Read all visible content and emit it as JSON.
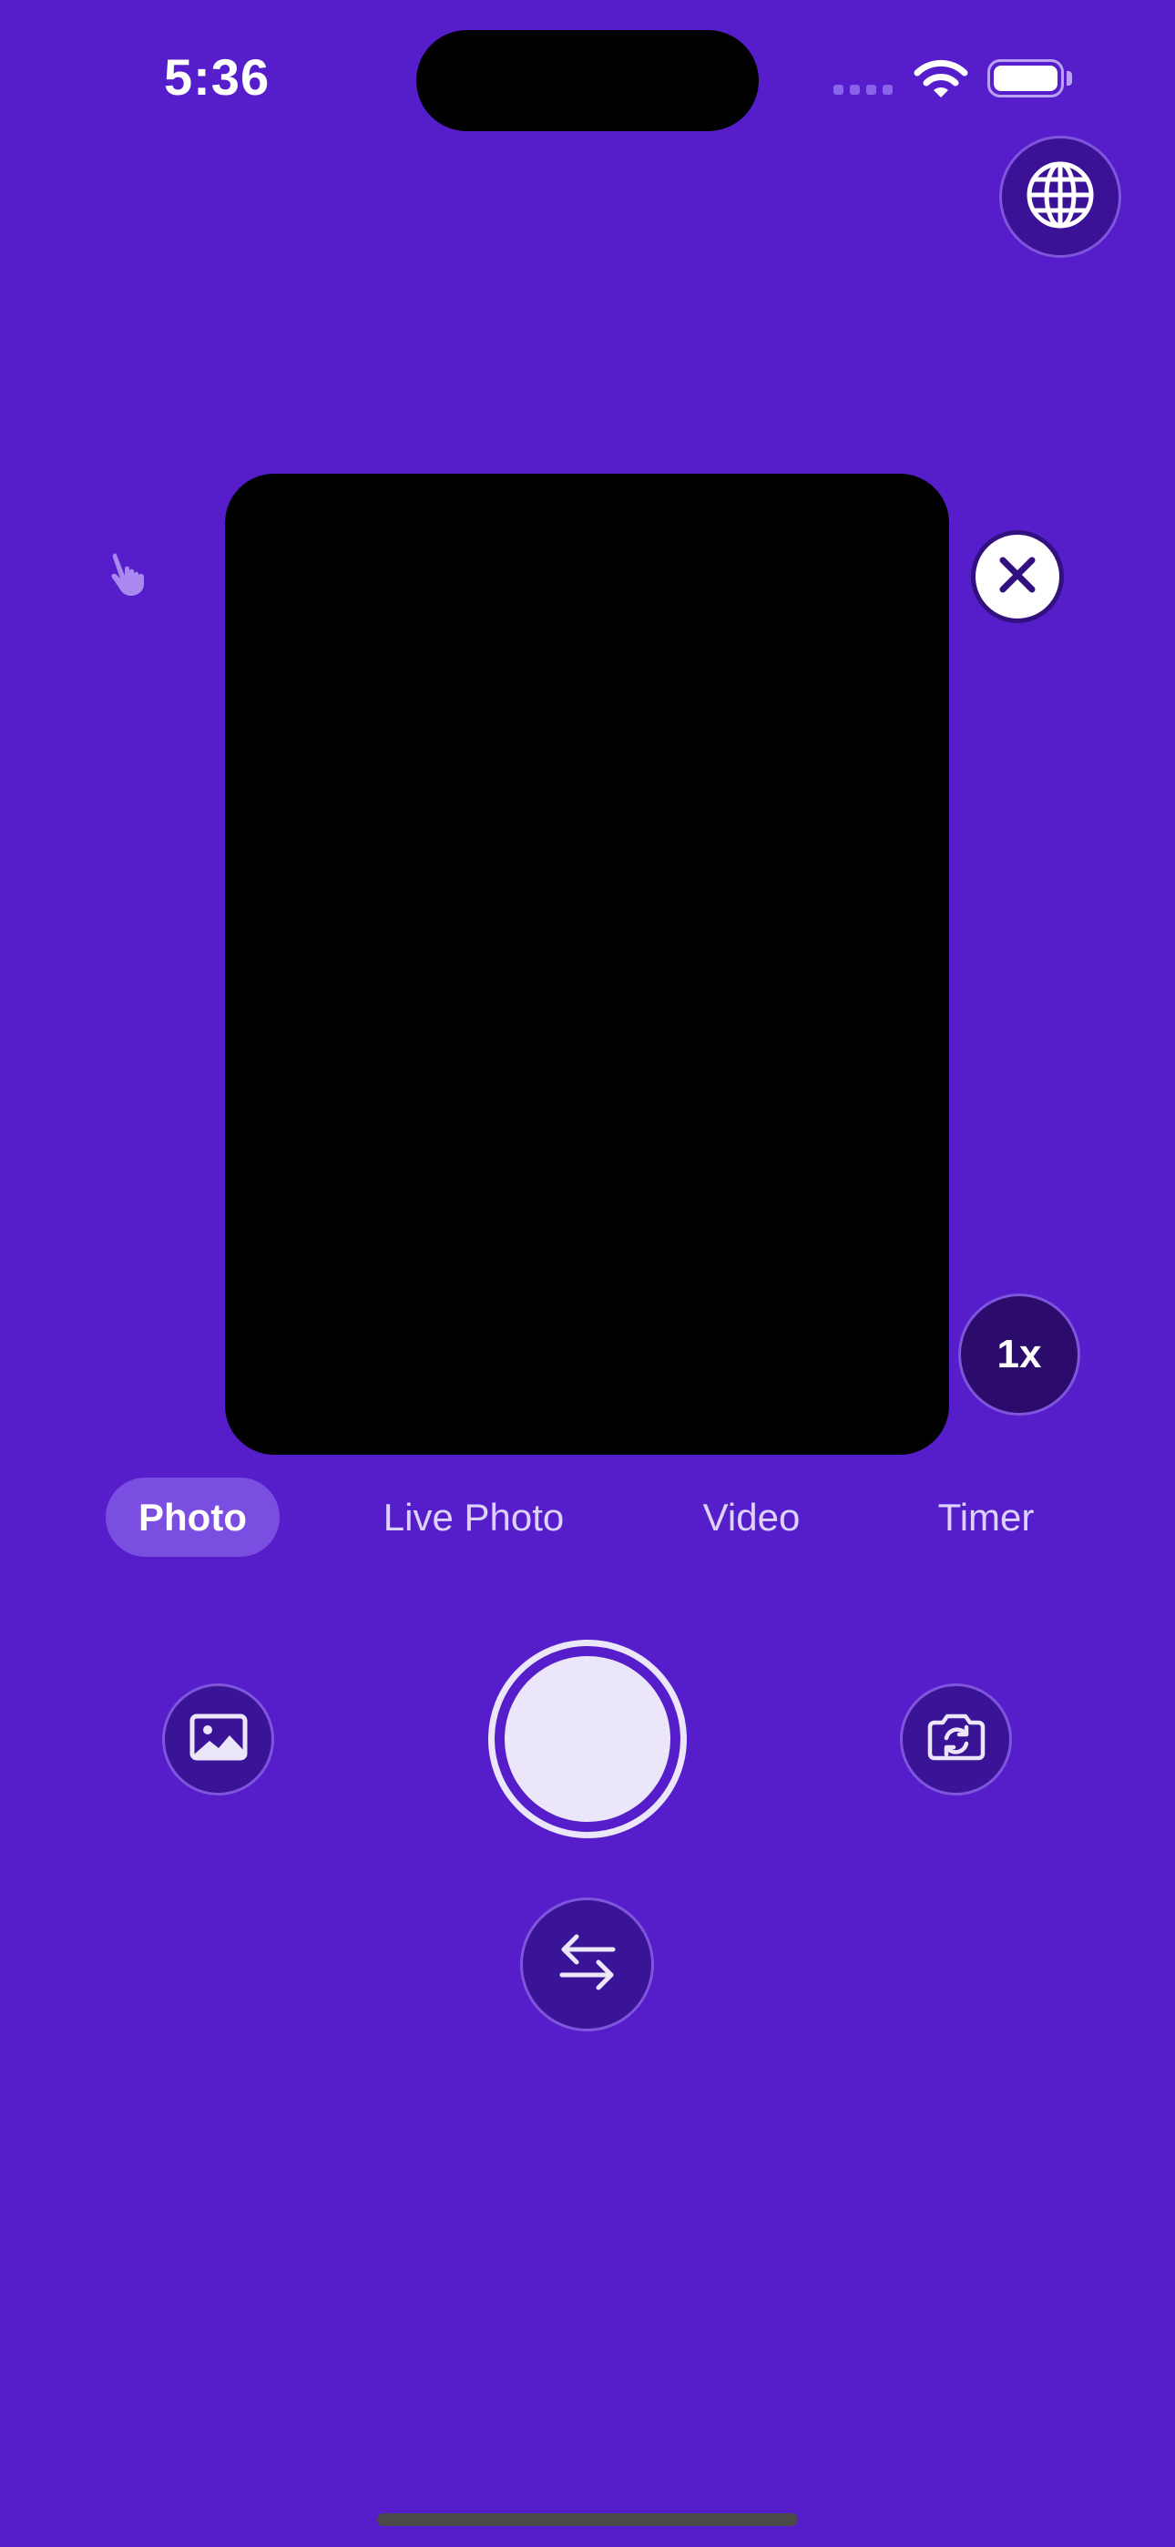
{
  "status_bar": {
    "time": "5:36",
    "icons": [
      "cellular-signal-icon",
      "wifi-icon",
      "battery-icon"
    ]
  },
  "top_controls": {
    "globe_icon": "globe-icon"
  },
  "viewfinder": {
    "close_icon": "close-icon",
    "gesture_icon": "hand-pointer-icon",
    "zoom_label": "1x"
  },
  "modes": {
    "items": [
      {
        "label": "Photo",
        "selected": true
      },
      {
        "label": "Live Photo",
        "selected": false
      },
      {
        "label": "Video",
        "selected": false
      },
      {
        "label": "Timer",
        "selected": false
      }
    ]
  },
  "bottom_controls": {
    "gallery_icon": "photo-library-icon",
    "shutter": "shutter-button",
    "flip_icon": "camera-flip-icon",
    "switch_icon": "swap-arrows-icon"
  },
  "colors": {
    "background": "#561ecb",
    "button_fill": "#3a1496",
    "button_border": "#7e55dc",
    "active_tab": "#7a4ee0",
    "shutter": "#ece6fb"
  }
}
